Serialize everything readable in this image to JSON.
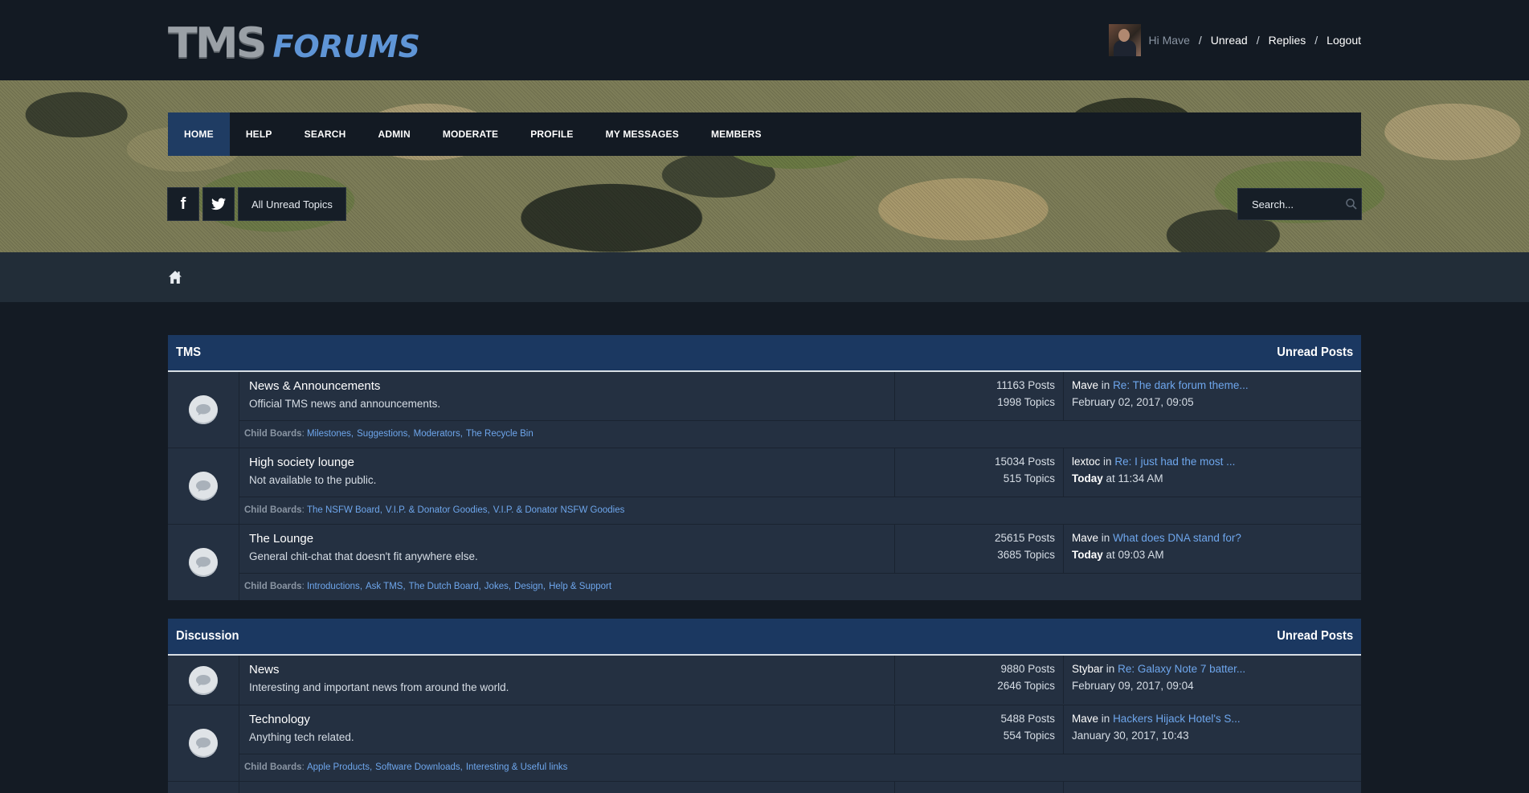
{
  "header": {
    "logo_tms": "TMS",
    "logo_forums": "FORUMS",
    "greeting": "Hi Mave",
    "links": [
      "Unread",
      "Replies",
      "Logout"
    ]
  },
  "nav": {
    "items": [
      "HOME",
      "HELP",
      "SEARCH",
      "ADMIN",
      "MODERATE",
      "PROFILE",
      "MY MESSAGES",
      "MEMBERS"
    ],
    "active": "HOME"
  },
  "toolbar": {
    "facebook_glyph": "f",
    "unread_topics": "All Unread Topics",
    "search_placeholder": "Search..."
  },
  "icons": {
    "facebook": "facebook-icon",
    "twitter": "twitter-icon",
    "search": "search-icon",
    "home": "home-icon",
    "board": "speech-bubble-icon"
  },
  "colors": {
    "page_bg": "#141b24",
    "accent": "#1f3c63",
    "link": "#6ea6ec",
    "row_bg": "#243041"
  },
  "categories": [
    {
      "title": "TMS",
      "unread_label": "Unread Posts",
      "boards": [
        {
          "name": "News & Announcements",
          "desc": "Official TMS news and announcements.",
          "posts": "11163 Posts",
          "topics": "1998 Topics",
          "last_user": "Mave",
          "last_in": "in",
          "last_title": "Re: The dark forum theme...",
          "last_date_bold": "",
          "last_date": "February 02, 2017, 09:05",
          "child_label": "Child Boards",
          "children": [
            "Milestones",
            "Suggestions",
            "Moderators",
            "The Recycle Bin"
          ]
        },
        {
          "name": "High society lounge",
          "desc": "Not available to the public.",
          "posts": "15034 Posts",
          "topics": "515 Topics",
          "last_user": "lextoc",
          "last_in": "in",
          "last_title": "Re: I just had the most ...",
          "last_date_bold": "Today",
          "last_date": " at 11:34 AM",
          "child_label": "Child Boards",
          "children": [
            "The NSFW Board",
            "V.I.P. & Donator Goodies",
            "V.I.P. & Donator NSFW Goodies"
          ]
        },
        {
          "name": "The Lounge",
          "desc": "General chit-chat that doesn't fit anywhere else.",
          "posts": "25615 Posts",
          "topics": "3685 Topics",
          "last_user": "Mave",
          "last_in": "in",
          "last_title": "What does DNA stand for?",
          "last_date_bold": "Today",
          "last_date": " at 09:03 AM",
          "child_label": "Child Boards",
          "children": [
            "Introductions",
            "Ask TMS",
            "The Dutch Board",
            "Jokes",
            "Design",
            "Help & Support"
          ]
        }
      ]
    },
    {
      "title": "Discussion",
      "unread_label": "Unread Posts",
      "boards": [
        {
          "name": "News",
          "desc": "Interesting and important news from around the world.",
          "posts": "9880 Posts",
          "topics": "2646 Topics",
          "last_user": "Stybar",
          "last_in": "in",
          "last_title": "Re: Galaxy Note 7 batter...",
          "last_date_bold": "",
          "last_date": "February 09, 2017, 09:04",
          "child_label": "",
          "children": []
        },
        {
          "name": "Technology",
          "desc": "Anything tech related.",
          "posts": "5488 Posts",
          "topics": "554 Topics",
          "last_user": "Mave",
          "last_in": "in",
          "last_title": "Hackers Hijack Hotel's S...",
          "last_date_bold": "",
          "last_date": "January 30, 2017, 10:43",
          "child_label": "Child Boards",
          "children": [
            "Apple Products",
            "Software Downloads",
            "Interesting & Useful links"
          ]
        }
      ]
    }
  ]
}
